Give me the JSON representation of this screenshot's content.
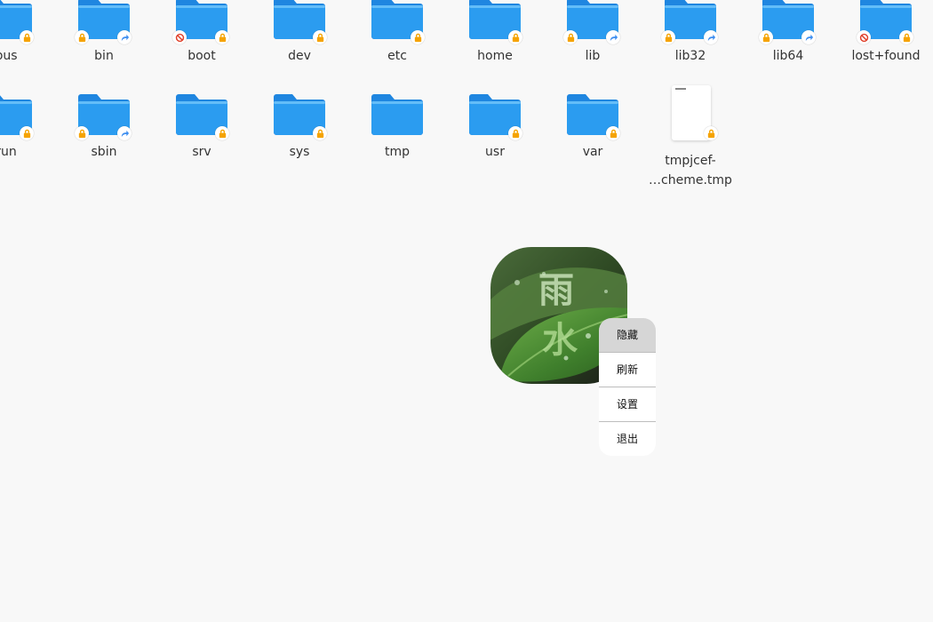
{
  "row1": [
    {
      "label": "bus",
      "badges": [
        "lock-icon"
      ]
    },
    {
      "label": "bin",
      "badges": [
        "lock-icon",
        "symlink-arrow-icon"
      ]
    },
    {
      "label": "boot",
      "badges": [
        "no-access-icon",
        "lock-icon"
      ]
    },
    {
      "label": "dev",
      "badges": [
        "lock-icon"
      ]
    },
    {
      "label": "etc",
      "badges": [
        "lock-icon"
      ]
    },
    {
      "label": "home",
      "badges": [
        "lock-icon"
      ]
    },
    {
      "label": "lib",
      "badges": [
        "lock-icon",
        "symlink-arrow-icon"
      ]
    },
    {
      "label": "lib32",
      "badges": [
        "lock-icon",
        "symlink-arrow-icon"
      ]
    },
    {
      "label": "lib64",
      "badges": [
        "lock-icon",
        "symlink-arrow-icon"
      ]
    },
    {
      "label": "lost+found",
      "badges": [
        "no-access-icon",
        "lock-icon"
      ]
    }
  ],
  "row2": [
    {
      "label": "run",
      "badges": [
        "lock-icon"
      ]
    },
    {
      "label": "sbin",
      "badges": [
        "lock-icon",
        "symlink-arrow-icon"
      ]
    },
    {
      "label": "srv",
      "badges": [
        "lock-icon"
      ]
    },
    {
      "label": "sys",
      "badges": [
        "lock-icon"
      ]
    },
    {
      "label": "tmp",
      "badges": []
    },
    {
      "label": "usr",
      "badges": [
        "lock-icon"
      ]
    },
    {
      "label": "var",
      "badges": [
        "lock-icon"
      ]
    },
    {
      "label_line1": "tmpjcef-",
      "label_line2": "…cheme.tmp",
      "badges": [
        "lock-icon"
      ],
      "type": "file"
    }
  ],
  "widget": {
    "chars": [
      "雨",
      "水"
    ],
    "menu": [
      "隐藏",
      "刷新",
      "设置",
      "退出"
    ]
  },
  "colors": {
    "background": "#f8f8f8",
    "folder_blue": "#2b9cf0",
    "folder_tab": "#1f86e0",
    "lock_orange": "#f5a300",
    "no_access_red": "#e0402a",
    "symlink_blue": "#3d8ef0"
  }
}
